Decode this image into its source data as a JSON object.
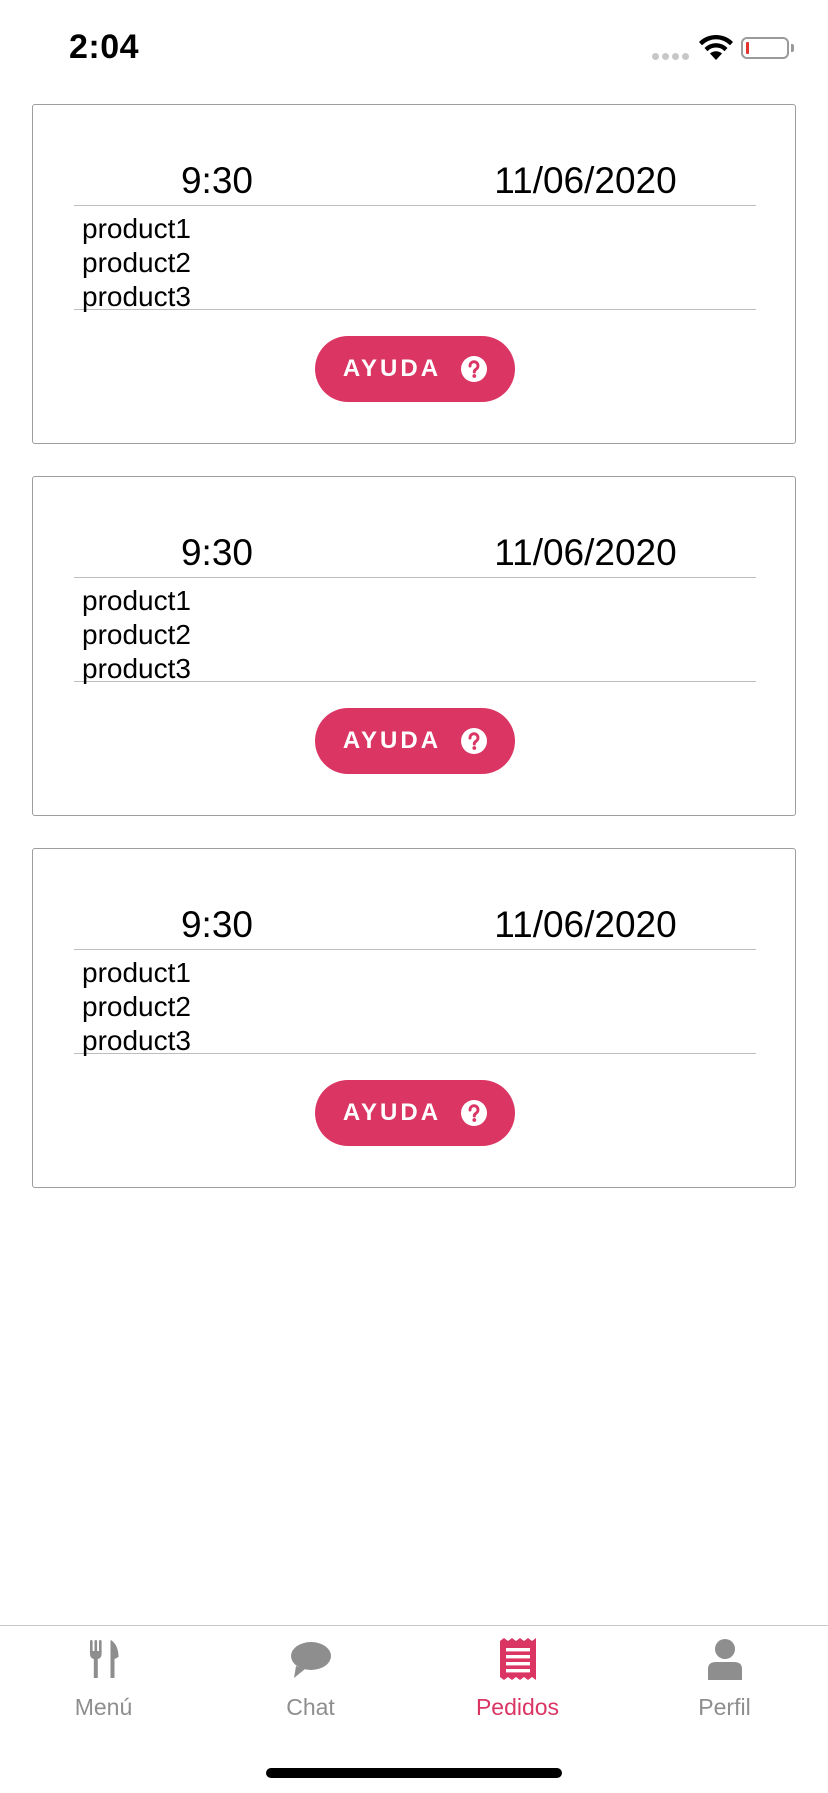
{
  "status_bar": {
    "time": "2:04"
  },
  "colors": {
    "accent": "#db3564",
    "inactive": "#8e8e8e",
    "card_border": "#9e9e9e"
  },
  "orders": [
    {
      "time": "9:30",
      "date": "11/06/2020",
      "products": [
        "product1",
        "product2",
        "product3"
      ],
      "help_label": "AYUDA"
    },
    {
      "time": "9:30",
      "date": "11/06/2020",
      "products": [
        "product1",
        "product2",
        "product3"
      ],
      "help_label": "AYUDA"
    },
    {
      "time": "9:30",
      "date": "11/06/2020",
      "products": [
        "product1",
        "product2",
        "product3"
      ],
      "help_label": "AYUDA"
    }
  ],
  "tab_bar": {
    "items": [
      {
        "label": "Menú",
        "icon": "fork-knife-icon",
        "active": false
      },
      {
        "label": "Chat",
        "icon": "chat-bubble-icon",
        "active": false
      },
      {
        "label": "Pedidos",
        "icon": "receipt-icon",
        "active": true
      },
      {
        "label": "Perfil",
        "icon": "person-icon",
        "active": false
      }
    ]
  }
}
